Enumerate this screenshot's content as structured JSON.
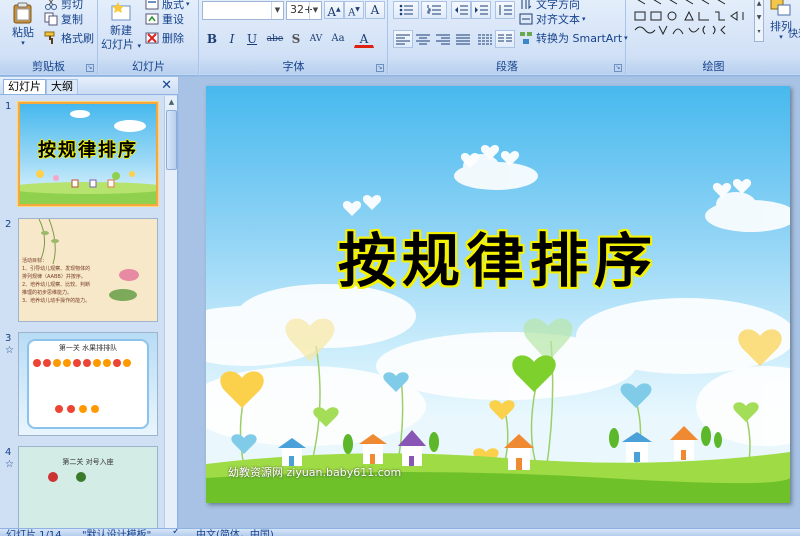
{
  "ribbon": {
    "clipboard": {
      "label": "剪贴板",
      "paste": "粘贴",
      "cut": "剪切",
      "copy": "复制",
      "format_painter": "格式刷"
    },
    "slides": {
      "label": "幻灯片",
      "new_slide_line1": "新建",
      "new_slide_line2": "幻灯片",
      "layout": "版式",
      "reset": "重设",
      "delete": "删除"
    },
    "font": {
      "label": "字体",
      "font_name": "",
      "font_size": "32+",
      "grow": "A",
      "shrink": "A",
      "clear": "A",
      "bold": "B",
      "italic": "I",
      "underline": "U",
      "strike": "abe",
      "shadow": "S",
      "spacing": "AV",
      "case": "Aa",
      "color": "A"
    },
    "paragraph": {
      "label": "段落",
      "text_direction": "文字方向",
      "align_text": "对齐文本",
      "convert_smartart": "转换为 SmartArt"
    },
    "drawing": {
      "label": "绘图",
      "arrange": "排列",
      "quick_styles": "快速"
    }
  },
  "panel": {
    "tab_slides": "幻灯片",
    "tab_outline": "大纲",
    "close": "✕",
    "thumbnails": [
      {
        "number": "1",
        "title": "按规律排序"
      },
      {
        "number": "2",
        "lines": [
          "活动目标：",
          "1、引导幼儿观察、发现物体的",
          "排列规律（AABB）并按序。",
          "2、培养幼儿观察、比较、判断",
          "推理的初步思维能力。",
          "3、培养幼儿动手操作的能力。"
        ]
      },
      {
        "number": "3",
        "star": "☆",
        "title": "第一关 水果排排队"
      },
      {
        "number": "4",
        "star": "☆",
        "title": "第二关 对号入座"
      }
    ]
  },
  "slide": {
    "title": "按规律排序",
    "watermark": "幼教资源网 ziyuan.baby611.com"
  },
  "status": {
    "slide_count": "幻灯片 1/14",
    "theme": "\"默认设计模板\"",
    "language": "中文(简体，中国)"
  },
  "colors": {
    "ribbon_bg": "#d2e1f6",
    "title_fill": "#000000",
    "title_outline": "#f5f200",
    "selected_thumb": "#f7a83a"
  }
}
